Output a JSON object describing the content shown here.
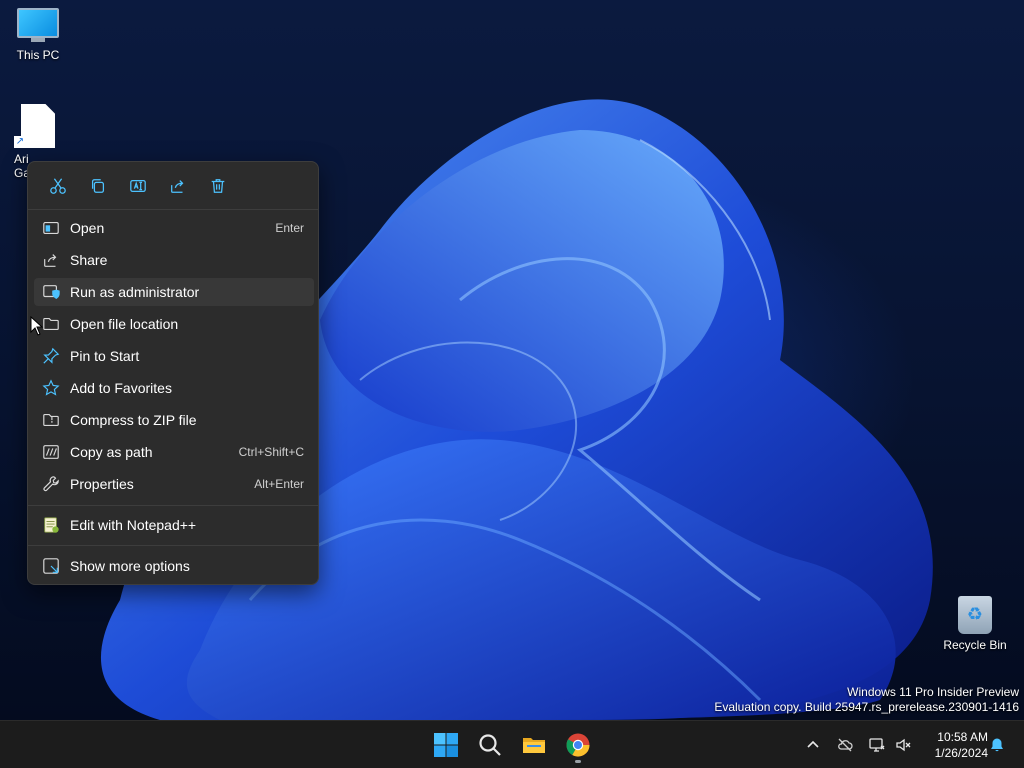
{
  "desktop": {
    "icons": [
      {
        "label": "This PC"
      },
      {
        "label": "Ari\nGa"
      },
      {
        "label": "Recycle Bin"
      }
    ],
    "watermark": {
      "line1": "Windows 11 Pro Insider Preview",
      "line2": "Evaluation copy. Build 25947.rs_prerelease.230901-1416"
    }
  },
  "context_menu": {
    "quick_actions": [
      {
        "icon": "cut-icon"
      },
      {
        "icon": "copy-icon"
      },
      {
        "icon": "rename-icon"
      },
      {
        "icon": "share-icon"
      },
      {
        "icon": "delete-icon"
      }
    ],
    "items": [
      {
        "label": "Open",
        "shortcut": "Enter",
        "icon": "open-icon"
      },
      {
        "label": "Share",
        "shortcut": "",
        "icon": "share-icon"
      },
      {
        "label": "Run as administrator",
        "shortcut": "",
        "icon": "shield-icon"
      },
      {
        "label": "Open file location",
        "shortcut": "",
        "icon": "folder-icon"
      },
      {
        "label": "Pin to Start",
        "shortcut": "",
        "icon": "pin-icon"
      },
      {
        "label": "Add to Favorites",
        "shortcut": "",
        "icon": "star-icon"
      },
      {
        "label": "Compress to ZIP file",
        "shortcut": "",
        "icon": "zip-folder-icon"
      },
      {
        "label": "Copy as path",
        "shortcut": "Ctrl+Shift+C",
        "icon": "copy-path-icon"
      },
      {
        "label": "Properties",
        "shortcut": "Alt+Enter",
        "icon": "wrench-icon"
      },
      {
        "label": "Edit with Notepad++",
        "shortcut": "",
        "icon": "notepadpp-icon"
      },
      {
        "label": "Show more options",
        "shortcut": "",
        "icon": "more-options-icon"
      }
    ]
  },
  "taskbar": {
    "apps": [
      {
        "name": "Start",
        "icon": "windows-start-icon"
      },
      {
        "name": "Search",
        "icon": "search-icon"
      },
      {
        "name": "File Explorer",
        "icon": "file-explorer-icon"
      },
      {
        "name": "Google Chrome",
        "icon": "chrome-icon"
      }
    ],
    "tray": {
      "time": "10:58 AM",
      "date": "1/26/2024"
    }
  },
  "colors": {
    "menu_bg": "#2c2c2c",
    "accent": "#4cc2ff",
    "taskbar_bg": "#1c1c1c"
  }
}
